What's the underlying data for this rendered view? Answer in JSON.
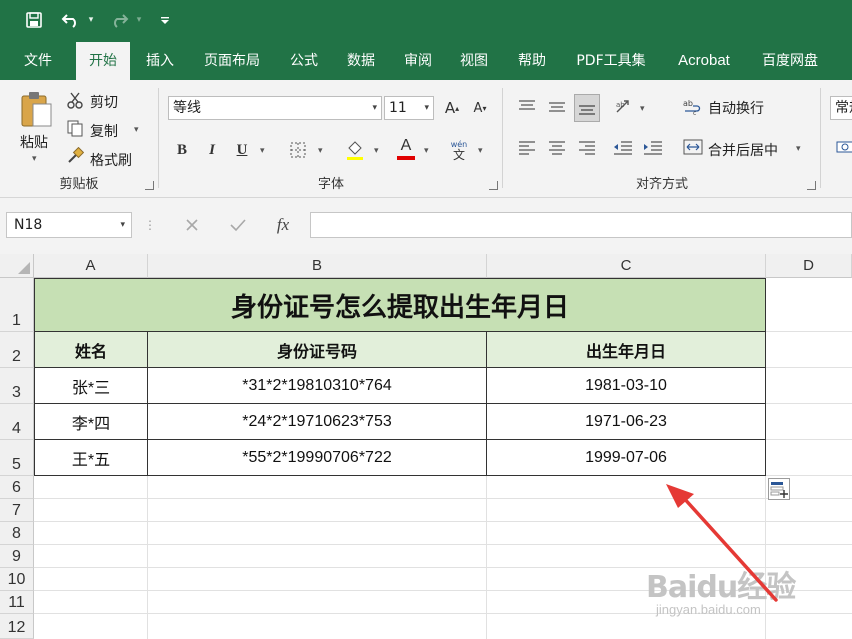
{
  "qat": {
    "save_icon": "save-icon",
    "undo_icon": "undo-icon",
    "redo_icon": "redo-icon",
    "customize_icon": "customize-qat-icon"
  },
  "tabs": [
    "文件",
    "开始",
    "插入",
    "页面布局",
    "公式",
    "数据",
    "审阅",
    "视图",
    "帮助",
    "PDF工具集",
    "Acrobat",
    "百度网盘"
  ],
  "active_tab": "开始",
  "ribbon": {
    "clipboard": {
      "label": "剪贴板",
      "paste": "粘贴",
      "cut": "剪切",
      "copy": "复制",
      "format_painter": "格式刷"
    },
    "font": {
      "label": "字体",
      "font_name": "等线",
      "font_size": "11",
      "bold": "B",
      "italic": "I",
      "underline": "U",
      "font_color_letter": "A",
      "font_color": "#e00000",
      "phonetic_top": "wén",
      "phonetic_bottom": "文"
    },
    "alignment": {
      "label": "对齐方式",
      "wrap_text": "自动换行",
      "merge_center": "合并后居中"
    },
    "number": {
      "format": "常规"
    }
  },
  "formula_bar": {
    "name_box": "N18",
    "fx": "fx",
    "value": ""
  },
  "sheet": {
    "columns": [
      "A",
      "B",
      "C",
      "D"
    ],
    "rows": [
      "1",
      "2",
      "3",
      "4",
      "5",
      "6",
      "7",
      "8",
      "9",
      "10",
      "11",
      "12"
    ],
    "title": "身份证号怎么提取出生年月日",
    "headers": [
      "姓名",
      "身份证号码",
      "出生年月日"
    ],
    "data": [
      [
        "张*三",
        "*31*2*19810310*764",
        "1981-03-10"
      ],
      [
        "李*四",
        "*24*2*19710623*753",
        "1971-06-23"
      ],
      [
        "王*五",
        "*55*2*19990706*722",
        "1999-07-06"
      ]
    ]
  },
  "watermark": {
    "main": "Baidu经验",
    "sub": "jingyan.baidu.com"
  },
  "colors": {
    "accent": "#217346",
    "title_fill": "#c6e0b4",
    "header_fill": "#e2efda",
    "arrow": "#e53935"
  }
}
